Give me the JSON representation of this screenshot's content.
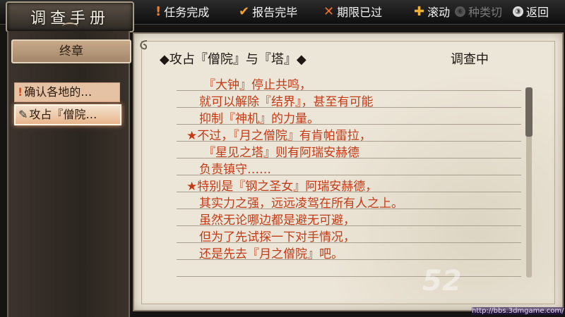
{
  "header": {
    "title": "调查手册"
  },
  "legend": [
    {
      "icon": "!",
      "label": "任务完成",
      "color": "#f08020"
    },
    {
      "icon": "✔",
      "label": "报告完毕",
      "color": "#f0a030"
    },
    {
      "icon": "✕",
      "label": "期限已过",
      "color": "#f07030"
    },
    {
      "icon": "✚",
      "label": "滚动",
      "color": "#f0b030"
    }
  ],
  "controls": {
    "sort_key": "⑥",
    "sort_label": "种类切",
    "back_key": "③",
    "back_label": "返回"
  },
  "sidebar": {
    "chapter": "终章",
    "items": [
      {
        "icon": "!",
        "label": "确认各地的…",
        "active": false
      },
      {
        "icon": "✎",
        "label": "攻占『僧院…",
        "active": true
      }
    ]
  },
  "document": {
    "title": "◆攻占『僧院』与『塔』◆",
    "status": "调查中",
    "lines": [
      "『大钟』停止共鸣，",
      "就可以解除『结界』，甚至有可能",
      "抑制『神机』的力量。",
      "★不过，『月之僧院』有肯帕雷拉，",
      "『星见之塔』则有阿瑞安赫德",
      "负责镇守……",
      "★特别是『钢之圣女』阿瑞安赫德，",
      "其实力之强，远远凌驾在所有人之上。",
      "虽然无论哪边都是避无可避，",
      "但为了先试探一下对手情况，",
      "还是先去『月之僧院』吧。"
    ]
  },
  "watermark": "52",
  "url": "http://bbs.3dmgame.com/"
}
